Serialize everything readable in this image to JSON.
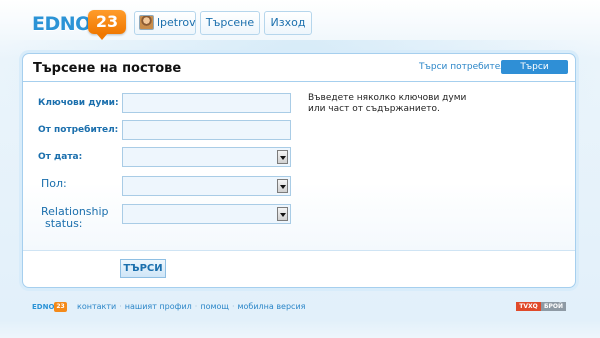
{
  "header": {
    "logo_text": "EDNO",
    "logo_badge": "23",
    "user_label": "lpetrov",
    "search_label": "Търсене",
    "exit_label": "Изход"
  },
  "panel": {
    "title": "Търсене на постове",
    "tab_users": "Търси потребители",
    "tab_posts": "Търси постове",
    "hint_line1": "Въведете няколко ключови думи",
    "hint_line2": "или част от съдържанието.",
    "search_button": "ТЪРСИ",
    "fields": {
      "keywords": {
        "label": "Ключови думи:",
        "value": ""
      },
      "from_user": {
        "label": "От потребител:",
        "value": ""
      },
      "from_date": {
        "label": "От дата:",
        "value": ""
      },
      "gender": {
        "label": "Пол:",
        "value": ""
      },
      "relationship_line1": "Relationship",
      "relationship_line2": "status:",
      "relationship_value": ""
    }
  },
  "footer": {
    "logo_text": "EDNO",
    "logo_badge": "23",
    "links": [
      "контакти",
      "нашият профил",
      "помощ",
      "мобилна версия"
    ],
    "partner_left": "TVXQ",
    "partner_right": "БРОЙ"
  },
  "colors": {
    "brand_blue": "#2b93d6",
    "brand_orange": "#f07800",
    "link_blue": "#1b6fad",
    "active_tab": "#2f8fd6"
  }
}
